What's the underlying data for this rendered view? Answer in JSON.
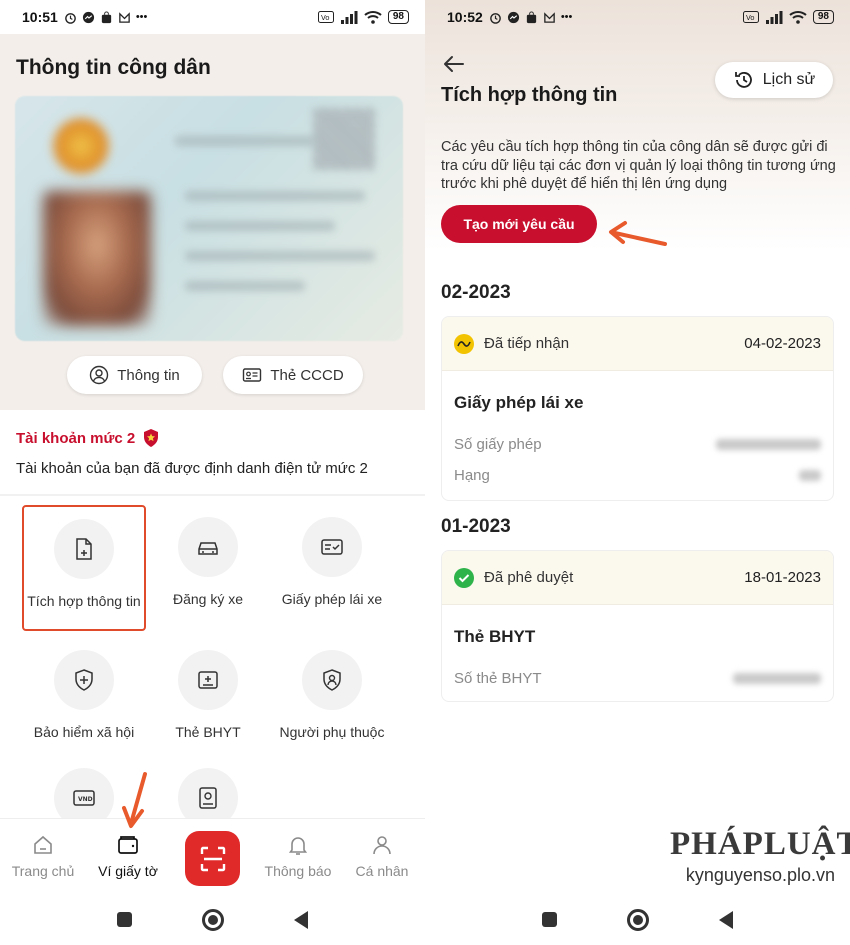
{
  "left": {
    "status": {
      "time": "10:51",
      "battery": "98"
    },
    "title": "Thông tin công dân",
    "card_buttons": {
      "info": "Thông tin",
      "cccd": "Thẻ CCCD"
    },
    "account": {
      "level": "Tài khoản mức 2",
      "description": "Tài khoản của bạn đã được định danh điện tử mức 2"
    },
    "services": [
      {
        "label": "Tích hợp thông tin",
        "icon": "document-add-icon"
      },
      {
        "label": "Đăng ký xe",
        "icon": "car-icon"
      },
      {
        "label": "Giấy phép lái xe",
        "icon": "license-card-icon"
      },
      {
        "label": "Bảo hiểm xã hội",
        "icon": "shield-plus-icon"
      },
      {
        "label": "Thẻ BHYT",
        "icon": "health-card-icon"
      },
      {
        "label": "Người phụ thuộc",
        "icon": "user-shield-icon"
      },
      {
        "label": "",
        "icon": "vnd-card-icon"
      },
      {
        "label": "",
        "icon": "id-portrait-icon"
      }
    ],
    "nav": {
      "home": "Trang chủ",
      "wallet": "Ví giấy tờ",
      "notifications": "Thông báo",
      "profile": "Cá nhân"
    }
  },
  "right": {
    "status": {
      "time": "10:52",
      "battery": "98"
    },
    "title": "Tích hợp thông tin",
    "history": "Lịch sử",
    "intro": "Các yêu cầu tích hợp thông tin của công dân sẽ được gửi đi tra cứu dữ liệu tại các đơn vị quản lý loại thông tin tương ứng trước khi phê duyệt để hiển thị lên ứng dụng",
    "new_request": "Tạo mới yêu cầu",
    "sections": [
      {
        "month": "02-2023",
        "status": "Đã tiếp nhận",
        "status_color": "#f2c300",
        "date": "04-02-2023",
        "doc_title": "Giấy phép lái xe",
        "rows": [
          "Số giấy phép",
          "Hạng"
        ]
      },
      {
        "month": "01-2023",
        "status": "Đã phê duyệt",
        "status_color": "#2db34a",
        "date": "18-01-2023",
        "doc_title": "Thẻ BHYT",
        "rows": [
          "Số thẻ BHYT"
        ]
      }
    ]
  },
  "watermark": {
    "logo": "PHÁPLUẬT",
    "site": "kynguyenso.plo.vn"
  },
  "colors": {
    "brand_red": "#c8102e",
    "annotation_arrow": "#e85a2c"
  }
}
